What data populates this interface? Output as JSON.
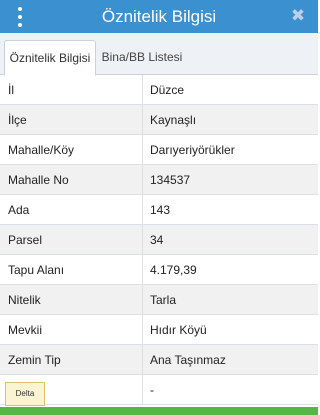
{
  "header": {
    "title": "Öznitelik Bilgisi",
    "menu_icon": "vertical-dots-icon",
    "close_icon": "close-x-icon",
    "color": "#3b91cf"
  },
  "tabs": [
    {
      "label": "Öznitelik Bilgisi",
      "active": true
    },
    {
      "label": "Bina/BB Listesi",
      "active": false
    }
  ],
  "attributes": [
    {
      "key": "İl",
      "value": "Düzce"
    },
    {
      "key": "İlçe",
      "value": "Kaynaşlı"
    },
    {
      "key": "Mahalle/Köy",
      "value": "Darıyeriyörükler"
    },
    {
      "key": "Mahalle No",
      "value": "134537"
    },
    {
      "key": "Ada",
      "value": "143"
    },
    {
      "key": "Parsel",
      "value": "34"
    },
    {
      "key": "Tapu Alanı",
      "value": "4.179,39"
    },
    {
      "key": "Nitelik",
      "value": "Tarla"
    },
    {
      "key": "Mevkii",
      "value": "Hıdır Köyü"
    },
    {
      "key": "Zemin Tip",
      "value": "Ana Taşınmaz"
    },
    {
      "key": "",
      "value": "-"
    }
  ],
  "logo": {
    "text": "Delta",
    "icon": "agency-logo"
  },
  "bottom_bar_color": "#55b845"
}
